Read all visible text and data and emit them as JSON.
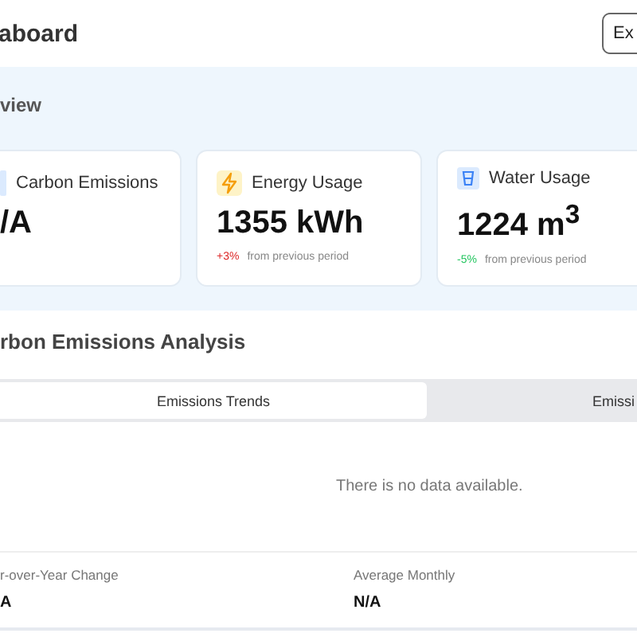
{
  "header": {
    "title": "aboard",
    "button": "Ex"
  },
  "overview": {
    "title": "view",
    "cards": [
      {
        "kind": "carbon",
        "label": "Carbon Emissions",
        "value": "/A"
      },
      {
        "kind": "energy",
        "label": "Energy Usage",
        "value": "1355 kWh",
        "change": "+3%",
        "increase": true,
        "note": "from previous period"
      },
      {
        "kind": "water",
        "label": "Water Usage",
        "value": "1224 m$^{3}$",
        "change": "-5%",
        "increase": false,
        "note": "from previous period"
      }
    ]
  },
  "analysis": {
    "title": "rbon Emissions Analysis",
    "tabs": [
      {
        "label": "Emissions Trends",
        "selected": true
      },
      {
        "label": "Emissi",
        "selected": false
      }
    ],
    "empty": "There is no data available.",
    "stats": [
      {
        "label": "r-over-Year Change",
        "value": "A"
      },
      {
        "label": "Average Monthly",
        "value": "N/A"
      }
    ]
  }
}
